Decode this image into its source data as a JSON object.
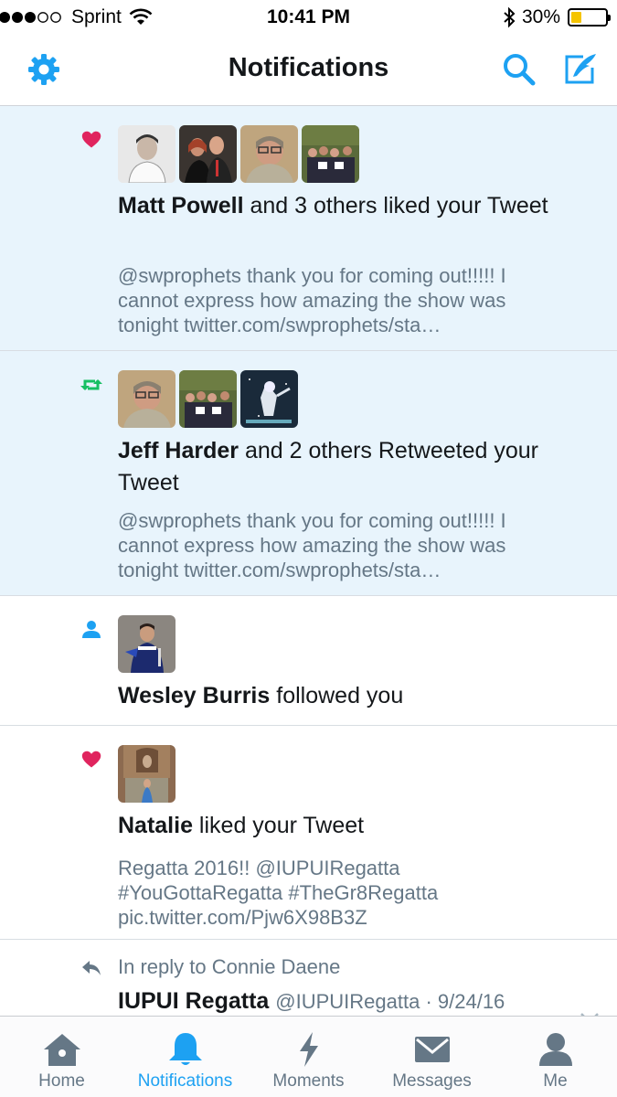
{
  "status_bar": {
    "carrier": "Sprint",
    "time": "10:41 PM",
    "battery_percent": "30%",
    "battery_level": 0.3,
    "signal_bars_filled": 3,
    "signal_bars_total": 5
  },
  "header": {
    "title": "Notifications",
    "settings_icon": "gear-icon",
    "search_icon": "search-icon",
    "compose_icon": "compose-icon",
    "accent_color": "#1da1f2"
  },
  "notifications": [
    {
      "type": "like",
      "icon": "heart-icon",
      "icon_color": "#e0245e",
      "actor": "Matt Powell",
      "action": " and 3 others liked your Tweet",
      "snippet": "@swprophets thank you for coming out!!!!! I cannot express how amazing the show was tonight twitter.com/swprophets/sta…"
    },
    {
      "type": "retweet",
      "icon": "retweet-icon",
      "icon_color": "#17bf63",
      "actor": "Jeff Harder",
      "action": " and 2 others Retweeted your Tweet",
      "snippet": "@swprophets thank you for coming out!!!!! I cannot express how amazing the show was tonight twitter.com/swprophets/sta…"
    },
    {
      "type": "follow",
      "icon": "person-icon",
      "icon_color": "#1da1f2",
      "actor": "Wesley Burris",
      "action": " followed you"
    },
    {
      "type": "like",
      "icon": "heart-icon",
      "icon_color": "#e0245e",
      "actor": "Natalie",
      "action": " liked your Tweet",
      "snippet": "Regatta 2016!! @IUPUIRegatta #YouGottaRegatta #TheGr8Regatta pic.twitter.com/Pjw6X98B3Z"
    }
  ],
  "reply_item": {
    "context": "In reply to Connie Daene",
    "author_name": "IUPUI Regatta",
    "author_handle": "@IUPUIRegatta",
    "separator": " · ",
    "date": "9/24/16"
  },
  "tab_bar": {
    "tabs": [
      {
        "label": "Home",
        "icon": "home-icon"
      },
      {
        "label": "Notifications",
        "icon": "bell-icon",
        "active": true
      },
      {
        "label": "Moments",
        "icon": "lightning-icon"
      },
      {
        "label": "Messages",
        "icon": "envelope-icon"
      },
      {
        "label": "Me",
        "icon": "person-icon"
      }
    ]
  }
}
